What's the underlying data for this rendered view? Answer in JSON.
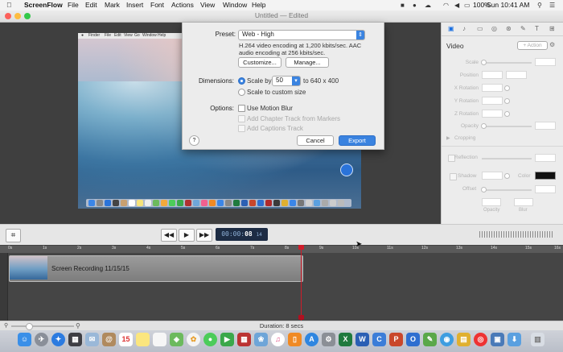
{
  "menubar": {
    "apple": "",
    "items": [
      "ScreenFlow",
      "File",
      "Edit",
      "Mark",
      "Insert",
      "Font",
      "Actions",
      "View",
      "Window",
      "Help"
    ],
    "battery": "100%",
    "clock": "Sun 10:41 AM"
  },
  "window": {
    "title": "Untitled",
    "edited": "— Edited"
  },
  "preview": {
    "inner_menu": [
      "Finder",
      "File",
      "Edit",
      "View",
      "Go",
      "Window",
      "Help"
    ]
  },
  "export_dialog": {
    "preset_label": "Preset:",
    "preset_value": "Web - High",
    "description": "H.264 video encoding at 1,200 kbits/sec. AAC audio encoding at 256 kbits/sec.",
    "customize_label": "Customize...",
    "manage_label": "Manage...",
    "dimensions_label": "Dimensions:",
    "scale_by_label": "Scale by",
    "scale_value": "50",
    "scale_result": "to 640 x 400",
    "custom_size_label": "Scale to custom size",
    "options_label": "Options:",
    "motion_blur_label": "Use Motion Blur",
    "chapter_track_label": "Add Chapter Track from Markers",
    "captions_track_label": "Add Captions Track",
    "help": "?",
    "cancel_label": "Cancel",
    "export_label": "Export"
  },
  "inspector": {
    "section_title": "Video",
    "add_action_label": "+ Action",
    "rows": [
      "Scale",
      "Position",
      "X Rotation",
      "Y Rotation",
      "Z Rotation",
      "Opacity"
    ],
    "cropping_label": "Cropping",
    "reflection_label": "Reflection",
    "shadow_label": "Shadow",
    "color_label": "Color",
    "offset_label": "Offset",
    "opacity_label": "Opacity",
    "blur_label": "Blur"
  },
  "playback": {
    "timecode_dim": "00:00:",
    "timecode_bold": "08",
    "timecode_frames": "14",
    "rewind": "◀◀",
    "play": "▶",
    "forward": "▶▶"
  },
  "ruler": [
    "0s",
    "1s",
    "2s",
    "3s",
    "4s",
    "5s",
    "6s",
    "7s",
    "8s",
    "9s",
    "10s",
    "11s",
    "12s",
    "13s",
    "14s",
    "15s",
    "16s"
  ],
  "timeline": {
    "clip_label": "Screen Recording 11/15/15"
  },
  "status": {
    "duration": "Duration: 8 secs"
  },
  "dock": {
    "icons": [
      "finder",
      "launchpad",
      "safari",
      "mission-control",
      "contacts",
      "calendar",
      "notes",
      "reminders",
      "maps",
      "photos",
      "messages",
      "facetime",
      "photo-booth",
      "iphoto",
      "itunes",
      "ibooks",
      "app-store",
      "system-prefs",
      "excel",
      "word",
      "powerpoint",
      "outlook",
      "screenflow",
      "chrome",
      "preview",
      "trash"
    ]
  }
}
